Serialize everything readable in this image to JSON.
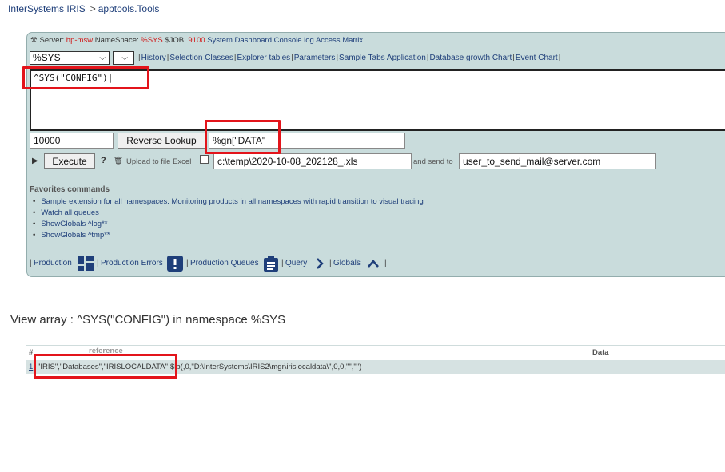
{
  "breadcrumb": {
    "home": "InterSystems IRIS",
    "separator": ">",
    "current": "apptools.Tools"
  },
  "info_bar": {
    "server_label": "Server:",
    "server_value": "hp-msw",
    "namespace_label": "NameSpace:",
    "namespace_value": "%SYS",
    "job_label": "$JOB:",
    "job_value": "9100",
    "links": [
      "System Dashboard",
      "Console log",
      "Access Matrix"
    ]
  },
  "namespace_select": {
    "value": "%SYS"
  },
  "nav_links": [
    "History",
    "Selection Classes",
    "Explorer tables",
    "Parameters",
    "Sample Tabs Application",
    "Database growth Chart",
    "Event Chart"
  ],
  "code_input": {
    "value": "^SYS(\"CONFIG\")"
  },
  "row3": {
    "limit_value": "10000",
    "reverse_lookup_label": "Reverse Lookup",
    "filter_value": "%gn[\"DATA\""
  },
  "row4": {
    "execute_label": "Execute",
    "help_label": "?",
    "upload_label": "Upload to file Excel",
    "file_path": "c:\\temp\\2020-10-08_202128_.xls",
    "send_label": "and send to",
    "email": "user_to_send_mail@server.com"
  },
  "favorites": {
    "title": "Favorites commands",
    "items": [
      "Sample extension for all namespaces. Monitoring products in all namespaces with rapid transition to visual tracing",
      "Watch all queues",
      "ShowGlobals ^log**",
      "ShowGlobals ^tmp**"
    ]
  },
  "bottom_links": {
    "production": "Production",
    "production_errors": "Production Errors",
    "production_queues": "Production Queues",
    "query": "Query",
    "globals": "Globals"
  },
  "view_title": "View array : ^SYS(\"CONFIG\") in namespace %SYS",
  "table": {
    "columns": [
      "#",
      "reference",
      "Data"
    ],
    "rows": [
      {
        "num": "1",
        "reference": "\"IRIS\",\"Databases\",\"IRISLOCALDATA\"",
        "data": "$lb(,0,\"D:\\InterSystems\\IRIS2\\mgr\\irislocaldata\\\",0,0,\"\",\"\")"
      }
    ]
  },
  "colors": {
    "panel_bg": "#c9dcdc",
    "highlight": "#e3141b",
    "link": "#1f3f7a",
    "icon_blue": "#1f3f7a",
    "accent_red": "#d01818"
  }
}
